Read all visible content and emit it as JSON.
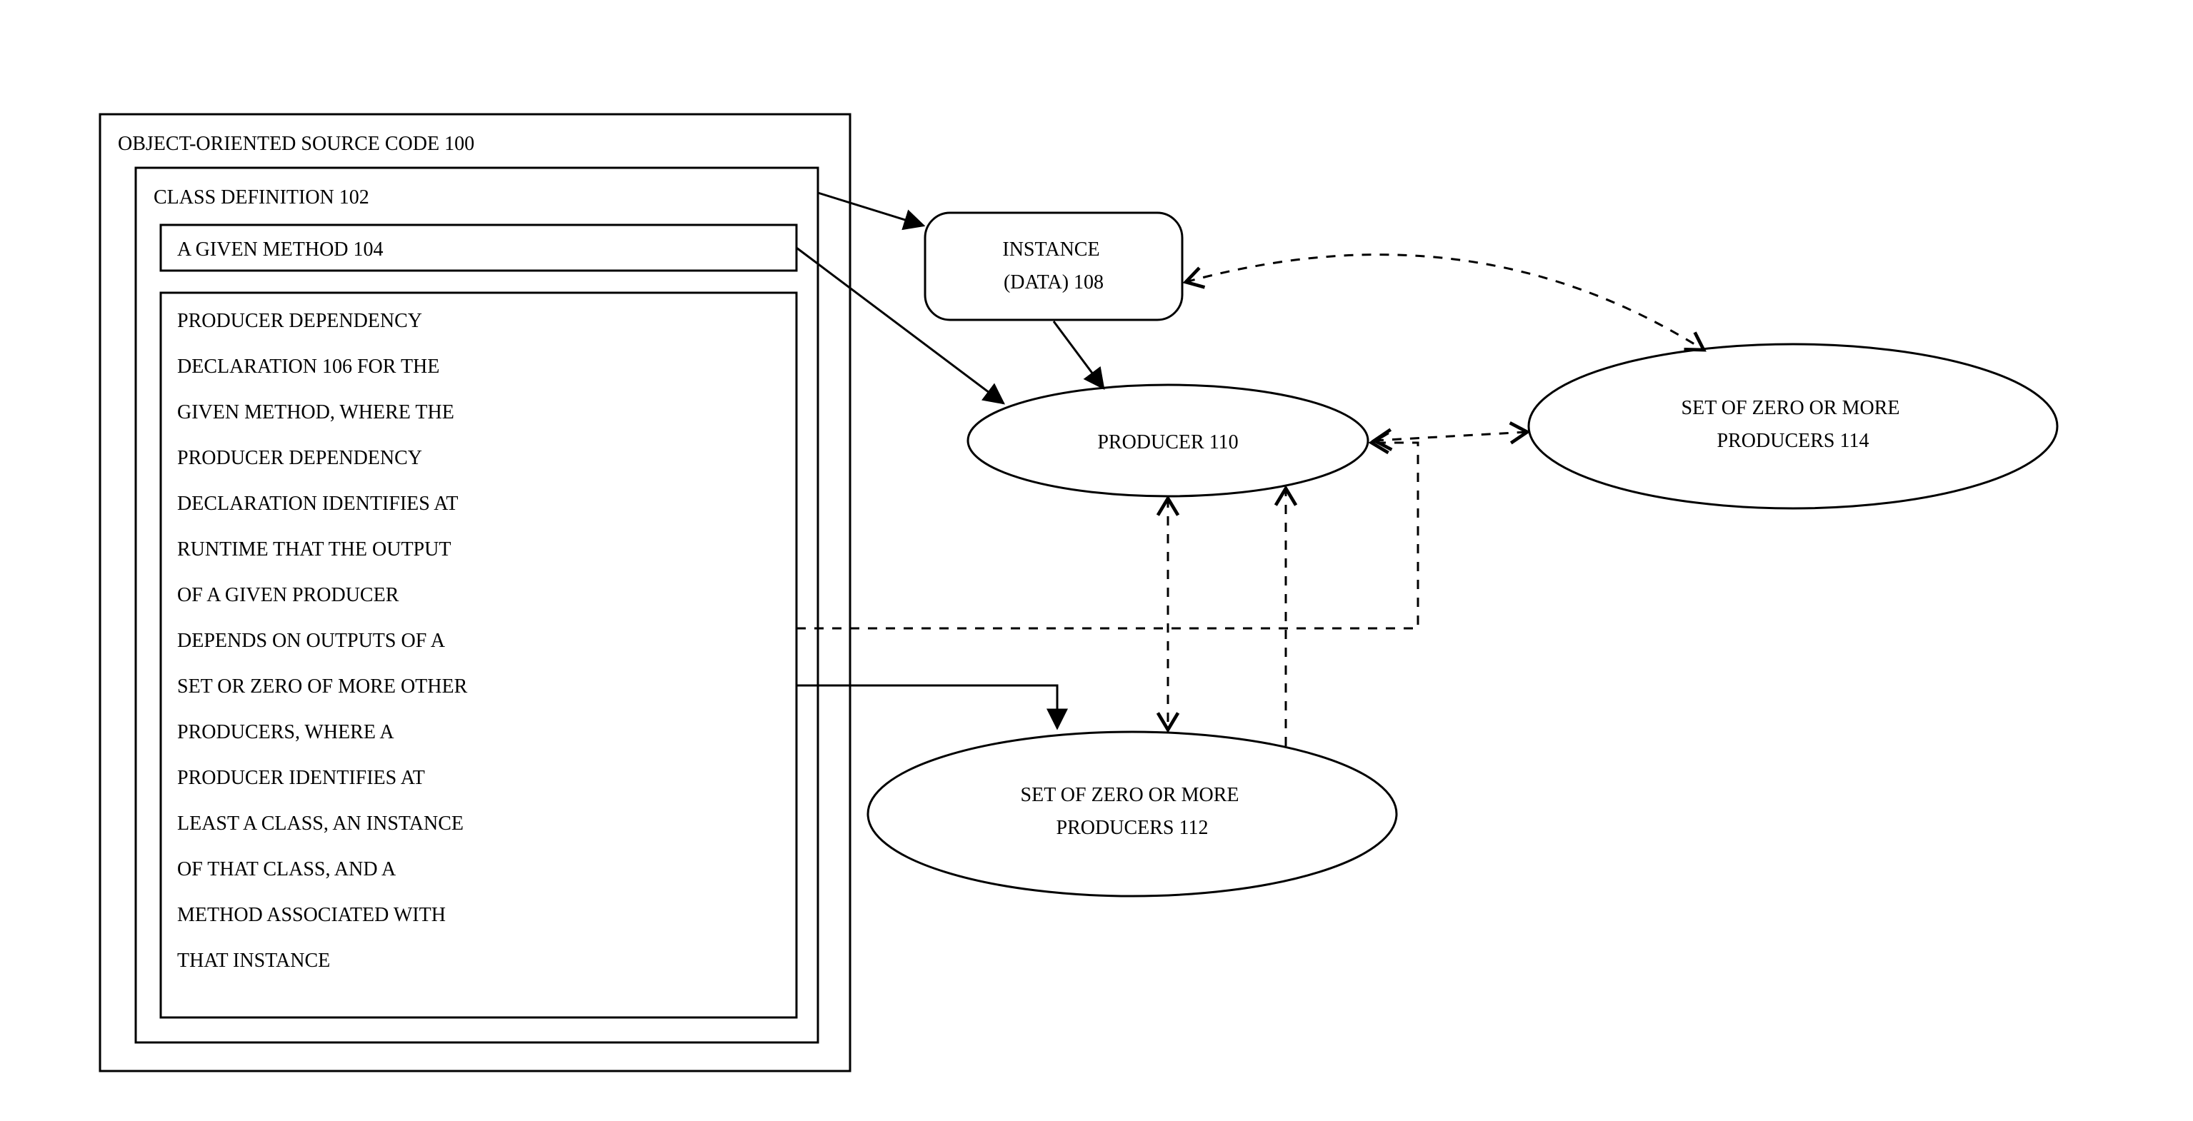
{
  "boxes": {
    "source_code": {
      "label": "OBJECT-ORIENTED SOURCE CODE 100"
    },
    "class_definition": {
      "label": "CLASS DEFINITION 102"
    },
    "given_method": {
      "label": "A GIVEN METHOD 104"
    },
    "producer_dependency": {
      "lines": [
        "PRODUCER DEPENDENCY",
        "DECLARATION 106 FOR THE",
        "GIVEN METHOD, WHERE THE",
        "PRODUCER DEPENDENCY",
        "DECLARATION IDENTIFIES AT",
        "RUNTIME THAT THE OUTPUT",
        "OF A GIVEN PRODUCER",
        "DEPENDS ON OUTPUTS OF A",
        "SET OR ZERO OF MORE OTHER",
        "PRODUCERS, WHERE A",
        "PRODUCER IDENTIFIES AT",
        "LEAST A CLASS, AN INSTANCE",
        "OF THAT CLASS, AND A",
        "METHOD ASSOCIATED WITH",
        "THAT INSTANCE"
      ]
    }
  },
  "nodes": {
    "instance": {
      "line1": "INSTANCE",
      "line2": "(DATA) 108"
    },
    "producer": {
      "label": "PRODUCER 110"
    },
    "producers_bottom": {
      "line1": "SET OF ZERO OR MORE",
      "line2": "PRODUCERS 112"
    },
    "producers_right": {
      "line1": "SET OF ZERO OR MORE",
      "line2": "PRODUCERS 114"
    }
  }
}
